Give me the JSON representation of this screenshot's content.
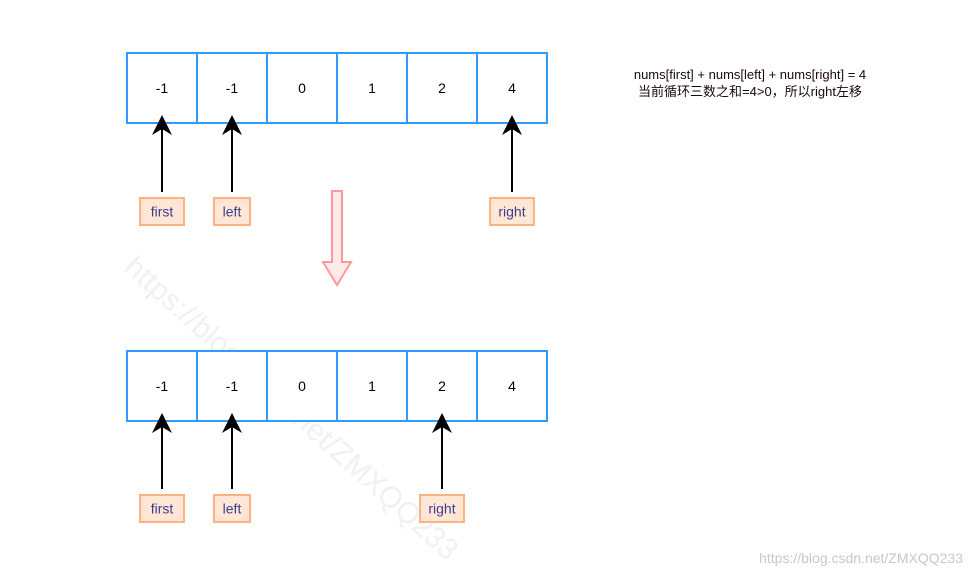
{
  "top_array": {
    "values": [
      "-1",
      "-1",
      "0",
      "1",
      "2",
      "4"
    ],
    "pointers": [
      {
        "label": "first",
        "index": 0
      },
      {
        "label": "left",
        "index": 1
      },
      {
        "label": "right",
        "index": 5
      }
    ]
  },
  "bottom_array": {
    "values": [
      "-1",
      "-1",
      "0",
      "1",
      "2",
      "4"
    ],
    "pointers": [
      {
        "label": "first",
        "index": 0
      },
      {
        "label": "left",
        "index": 1
      },
      {
        "label": "right",
        "index": 4
      }
    ]
  },
  "note": {
    "line1": "nums[first] + nums[left] + nums[right] = 4",
    "line2": "当前循环三数之和=4>0，所以right左移"
  },
  "watermark": "https://blog.csdn.net/ZMXQQ233",
  "footer_watermark": "https://blog.csdn.net/ZMXQQ233",
  "colors": {
    "cell_border": "#3399ff",
    "label_fill": "#ffe6d5",
    "label_border": "#ffb27f",
    "transition_arrow": "#ff9999"
  }
}
